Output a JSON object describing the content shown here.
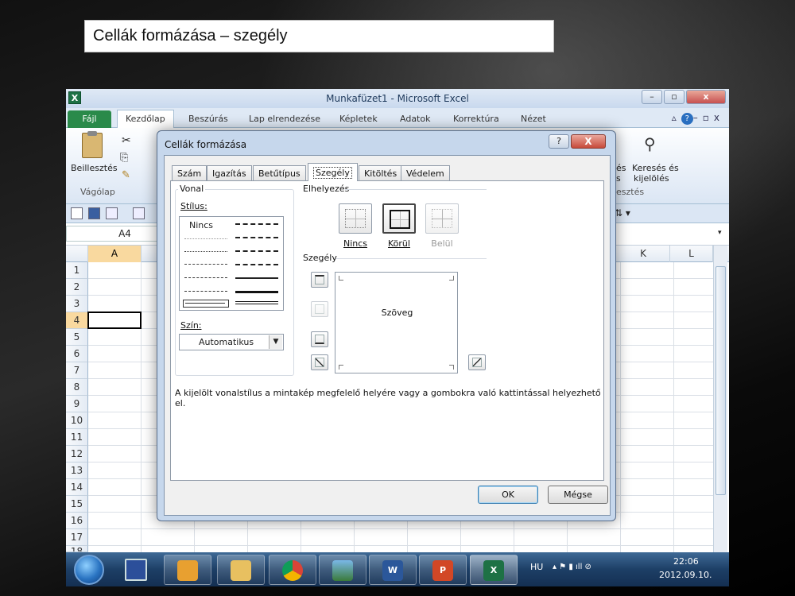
{
  "slide": {
    "title": "Cellák formázása – szegély"
  },
  "excel": {
    "window_title": "Munkafüzet1 - Microsoft Excel",
    "app_icon_letter": "X",
    "file_tab": "Fájl",
    "ribbon_tabs": [
      "Kezdőlap",
      "Beszúrás",
      "Lap elrendezése",
      "Képletek",
      "Adatok",
      "Korrektúra",
      "Nézet"
    ],
    "paste_label": "Beillesztés",
    "clipboard_group": "Vágólap",
    "right_group_labels": {
      "find_line1": "Keresés és",
      "find_line2": "kijelölés",
      "edit_line1": "és",
      "edit_line2": "s",
      "group_edit": "esztés"
    },
    "name_box": "A4",
    "columns_left": [
      "A"
    ],
    "columns_right": [
      "K",
      "L"
    ],
    "rows": [
      "1",
      "2",
      "3",
      "4",
      "5",
      "6",
      "7",
      "8",
      "9",
      "10",
      "11",
      "12",
      "13",
      "14",
      "15",
      "16",
      "17",
      "18"
    ],
    "selected_row": "4"
  },
  "dialog": {
    "title": "Cellák formázása",
    "help": "?",
    "close": "X",
    "tabs": [
      "Szám",
      "Igazítás",
      "Betűtípus",
      "Szegély",
      "Kitöltés",
      "Védelem"
    ],
    "active_tab": "Szegély",
    "line_group": "Vonal",
    "style_label": "Stílus:",
    "style_none": "Nincs",
    "color_label": "Szín:",
    "color_value": "Automatikus",
    "presets_group": "Elhelyezés",
    "presets": [
      {
        "label": "Nincs",
        "disabled": false
      },
      {
        "label": "Körül",
        "disabled": false
      },
      {
        "label": "Belül",
        "disabled": true
      }
    ],
    "border_group": "Szegély",
    "preview_text": "Szöveg",
    "hint": "A kijelölt vonalstílus a mintakép megfelelő helyére vagy a gombokra való kattintással helyezhető el.",
    "ok": "OK",
    "cancel": "Mégse"
  },
  "taskbar": {
    "language": "HU",
    "time": "22:06",
    "date": "2012.09.10."
  },
  "colors": {
    "excel_green": "#1e7145",
    "selection": "#f9d99f",
    "dialog_frame": "#c6d7ec"
  }
}
